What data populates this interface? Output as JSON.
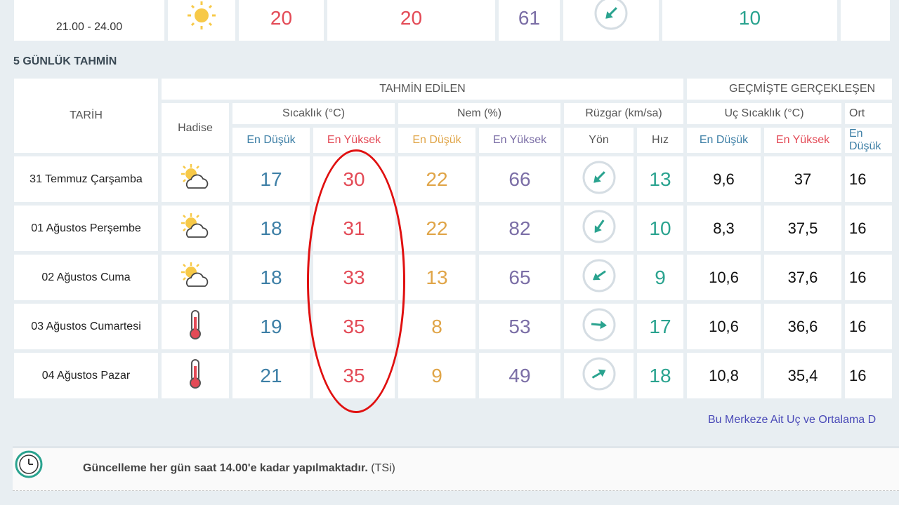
{
  "top_row": {
    "time": "21.00 - 24.00",
    "icon": "sun-icon",
    "values": [
      "20",
      "20",
      "61"
    ],
    "wind_dir_deg": 225,
    "wind_speed": "10"
  },
  "section_title": "5 GÜNLÜK TAHMİN",
  "headers": {
    "tarih": "TARİH",
    "forecast": "TAHMİN EDİLEN",
    "past": "GEÇMİŞTE GERÇEKLEŞEN",
    "hadise": "Hadise",
    "sicaklik": "Sıcaklık (°C)",
    "nem": "Nem (%)",
    "ruzgar": "Rüzgar (km/sa)",
    "uc_sicaklik": "Uç Sıcaklık (°C)",
    "ort": "Ort",
    "en_dusuk": "En Düşük",
    "en_yuksek": "En Yüksek",
    "yon": "Yön",
    "hiz": "Hız"
  },
  "colors": {
    "temp_low": "#3d7fa6",
    "temp_high": "#e34a56",
    "hum_low": "#e0a548",
    "hum_high": "#7b6ea6",
    "speed": "#2aa38f",
    "annotation": "#e01010"
  },
  "rows": [
    {
      "date": "31 Temmuz Çarşamba",
      "icon": "sun-cloud-icon",
      "t_low": "17",
      "t_high": "30",
      "h_low": "22",
      "h_high": "66",
      "wind_dir_deg": 225,
      "speed": "13",
      "past_low": "9,6",
      "past_high": "37",
      "ort": "16"
    },
    {
      "date": "01 Ağustos Perşembe",
      "icon": "sun-cloud-icon",
      "t_low": "18",
      "t_high": "31",
      "h_low": "22",
      "h_high": "82",
      "wind_dir_deg": 215,
      "speed": "10",
      "past_low": "8,3",
      "past_high": "37,5",
      "ort": "16"
    },
    {
      "date": "02 Ağustos Cuma",
      "icon": "sun-cloud-icon",
      "t_low": "18",
      "t_high": "33",
      "h_low": "13",
      "h_high": "65",
      "wind_dir_deg": 235,
      "speed": "9",
      "past_low": "10,6",
      "past_high": "37,6",
      "ort": "16"
    },
    {
      "date": "03 Ağustos Cumartesi",
      "icon": "thermometer-icon",
      "t_low": "19",
      "t_high": "35",
      "h_low": "8",
      "h_high": "53",
      "wind_dir_deg": 95,
      "speed": "17",
      "past_low": "10,6",
      "past_high": "36,6",
      "ort": "16"
    },
    {
      "date": "04 Ağustos Pazar",
      "icon": "thermometer-icon",
      "t_low": "21",
      "t_high": "35",
      "h_low": "9",
      "h_high": "49",
      "wind_dir_deg": 60,
      "speed": "18",
      "past_low": "10,8",
      "past_high": "35,4",
      "ort": "16"
    }
  ],
  "link_text": "Bu Merkeze Ait Uç ve Ortalama D",
  "notice": {
    "prefix": "Güncelleme her gün saat 14.00'e kadar yapılmaktadır.",
    "suffix": " (TSi)"
  }
}
